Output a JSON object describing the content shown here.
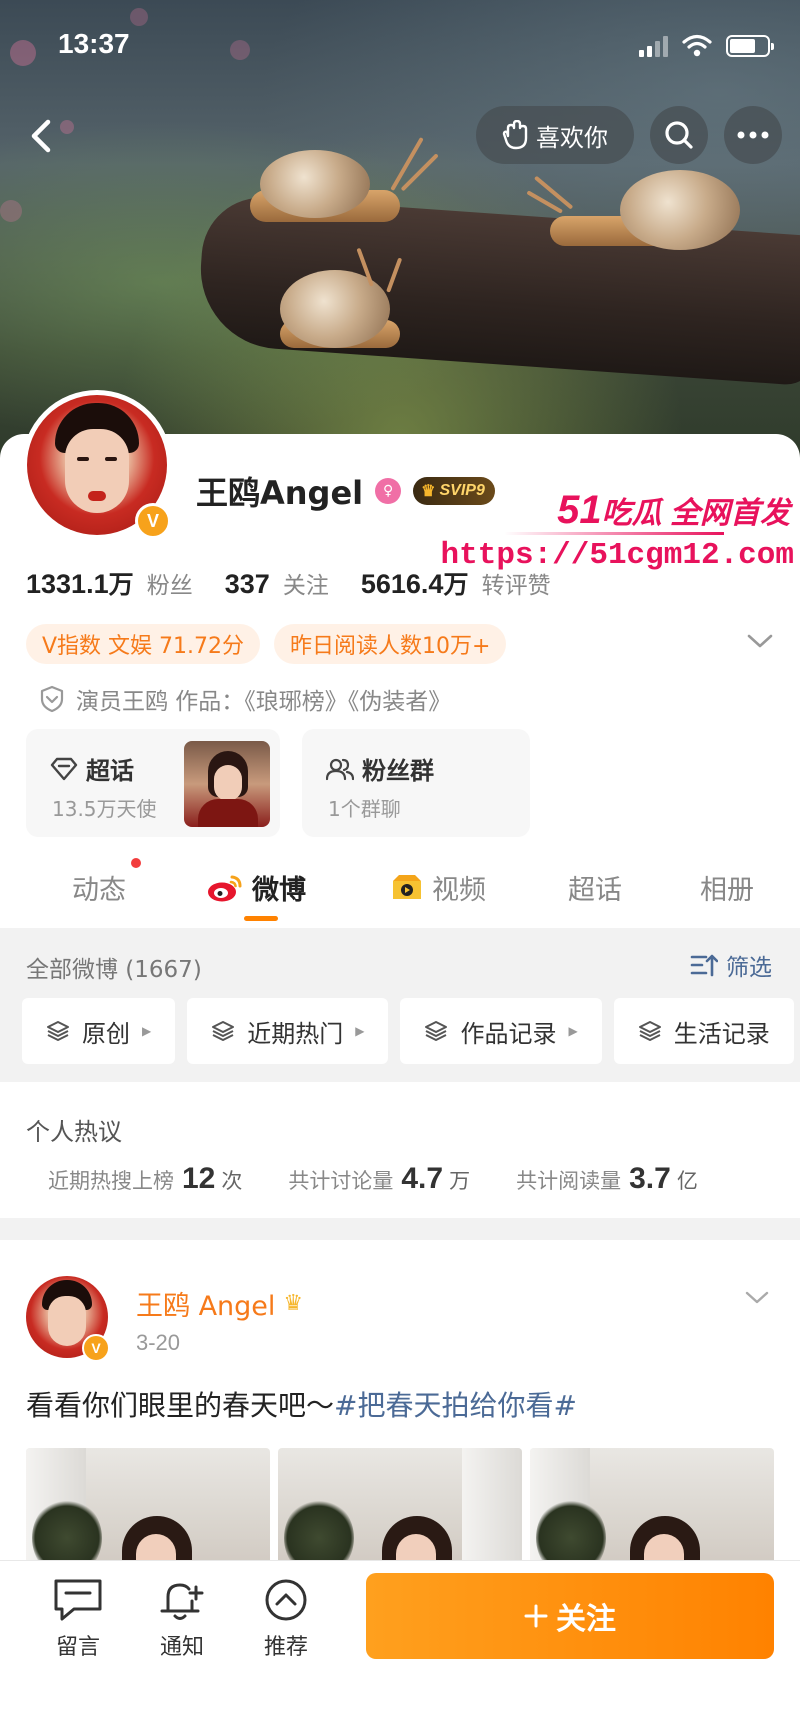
{
  "status": {
    "time": "13:37"
  },
  "nav": {
    "like_label": "喜欢你"
  },
  "profile": {
    "name": "王鸥Angel",
    "vip_level": "SVIP9",
    "verified_mark": "V",
    "stats": [
      {
        "value": "1331.1",
        "unit": "万",
        "label": "粉丝"
      },
      {
        "value": "337",
        "unit": "",
        "label": "关注"
      },
      {
        "value": "5616.4",
        "unit": "万",
        "label": "转评赞"
      }
    ],
    "chips": [
      "V指数 文娱 71.72分",
      "昨日阅读人数10万+"
    ],
    "certification": "演员王鸥 作品：《琅琊榜》《伪装者》",
    "feature_cards": [
      {
        "title": "超话",
        "subtitle": "13.5万天使",
        "icon": "diamond-icon"
      },
      {
        "title": "粉丝群",
        "subtitle": "1个群聊",
        "icon": "group-icon"
      }
    ]
  },
  "watermark": {
    "line1_big": "51",
    "line1_rest": "吃瓜 全网首发",
    "line2": "https://51cgm12.com"
  },
  "tabs": [
    {
      "label": "动态",
      "active": false,
      "badge": true
    },
    {
      "label": "微博",
      "active": true,
      "icon": "weibo-icon"
    },
    {
      "label": "视频",
      "active": false,
      "icon": "video-icon"
    },
    {
      "label": "超话",
      "active": false
    },
    {
      "label": "相册",
      "active": false
    }
  ],
  "filter": {
    "all_posts": "全部微博 (1667)",
    "filter_label": "筛选",
    "chips": [
      "原创",
      "近期热门",
      "作品记录",
      "生活记录"
    ]
  },
  "hot": {
    "title": "个人热议",
    "stats": [
      {
        "label": "近期热搜上榜",
        "value": "12",
        "unit": "次"
      },
      {
        "label": "共计讨论量",
        "value": "4.7",
        "unit": "万"
      },
      {
        "label": "共计阅读量",
        "value": "3.7",
        "unit": "亿"
      }
    ]
  },
  "post": {
    "author": "王鸥 Angel",
    "date": "3-20",
    "text": "看看你们眼里的春天吧～",
    "topic": "#把春天拍给你看#"
  },
  "bottom": {
    "items": [
      {
        "label": "留言",
        "icon": "comment-icon"
      },
      {
        "label": "通知",
        "icon": "bell-plus-icon"
      },
      {
        "label": "推荐",
        "icon": "chevron-up-circle-icon"
      }
    ],
    "follow_label": "关注"
  },
  "colors": {
    "accent": "#ff8200",
    "link": "#4b6a96",
    "chip_text": "#f67a1a",
    "watermark": "#e8125c"
  }
}
